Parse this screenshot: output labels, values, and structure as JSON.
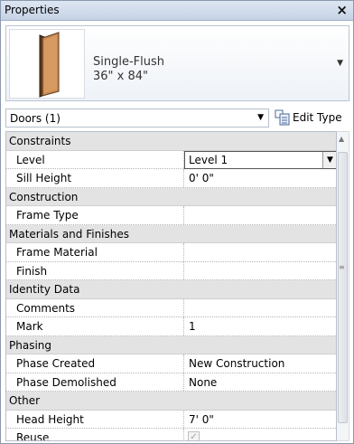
{
  "window": {
    "title": "Properties",
    "close_glyph": "×"
  },
  "type_selector": {
    "name_line1": "Single-Flush",
    "name_line2": "36\" x 84\"",
    "dropdown_icon": "chevron-down-icon"
  },
  "instance": {
    "label": "Doors (1)",
    "edit_type_label": "Edit Type",
    "edit_type_icon": "edit-type-icon"
  },
  "colors": {
    "category_bg": "#e3e3e3",
    "title_bar": "#c6d3e6"
  },
  "properties": {
    "cat_constraints": "Constraints",
    "level_name": "Level",
    "level_value": "Level 1",
    "sill_name": "Sill Height",
    "sill_value": "0'  0\"",
    "cat_construction": "Construction",
    "frame_type_name": "Frame Type",
    "frame_type_value": "",
    "cat_materials": "Materials and Finishes",
    "frame_material_name": "Frame Material",
    "frame_material_value": "",
    "finish_name": "Finish",
    "finish_value": "",
    "cat_identity": "Identity Data",
    "comments_name": "Comments",
    "comments_value": "",
    "mark_name": "Mark",
    "mark_value": "1",
    "cat_phasing": "Phasing",
    "phase_created_name": "Phase Created",
    "phase_created_value": "New Construction",
    "phase_demolished_name": "Phase Demolished",
    "phase_demolished_value": "None",
    "cat_other": "Other",
    "head_height_name": "Head Height",
    "head_height_value": "7'  0\"",
    "reuse_name": "Reuse",
    "reuse_checked": true
  }
}
